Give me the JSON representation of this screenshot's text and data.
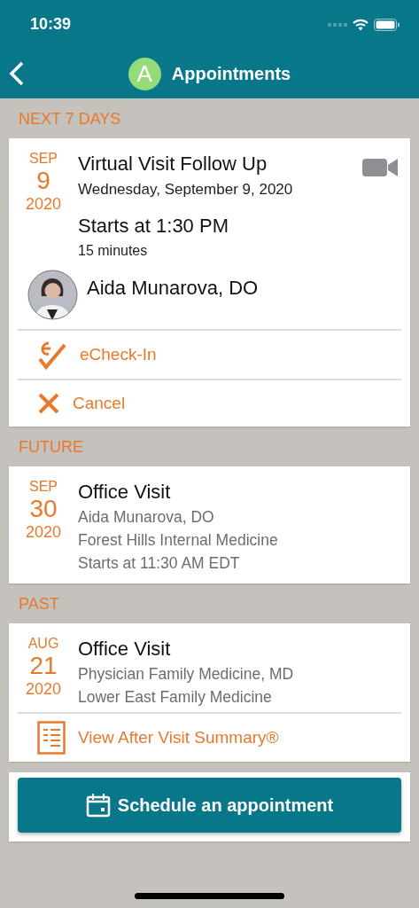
{
  "status_bar": {
    "time": "10:39"
  },
  "nav": {
    "avatar_letter": "A",
    "title": "Appointments"
  },
  "sections": [
    {
      "header": "NEXT 7 DAYS",
      "appointments": [
        {
          "kind": "virtual",
          "month": "SEP",
          "day": "9",
          "year": "2020",
          "title": "Virtual Visit Follow Up",
          "date_line": "Wednesday, September 9, 2020",
          "start": "Starts at 1:30 PM",
          "duration": "15 minutes",
          "provider": "Aida Munarova, DO",
          "actions": [
            {
              "kind": "echeckin",
              "label": "eCheck-In"
            },
            {
              "kind": "cancel",
              "label": "Cancel"
            }
          ]
        }
      ]
    },
    {
      "header": "FUTURE",
      "appointments": [
        {
          "kind": "summary",
          "month": "SEP",
          "day": "30",
          "year": "2020",
          "title": "Office Visit",
          "lines": [
            "Aida Munarova, DO",
            "Forest Hills Internal Medicine",
            "Starts at 11:30 AM EDT"
          ]
        }
      ]
    },
    {
      "header": "PAST",
      "appointments": [
        {
          "kind": "summary",
          "month": "AUG",
          "day": "21",
          "year": "2020",
          "title": "Office Visit",
          "lines": [
            "Physician Family Medicine, MD",
            "Lower East Family Medicine"
          ],
          "actions": [
            {
              "kind": "summary",
              "label": "View After Visit Summary®"
            }
          ]
        }
      ]
    }
  ],
  "schedule_button": {
    "label": "Schedule an appointment"
  }
}
